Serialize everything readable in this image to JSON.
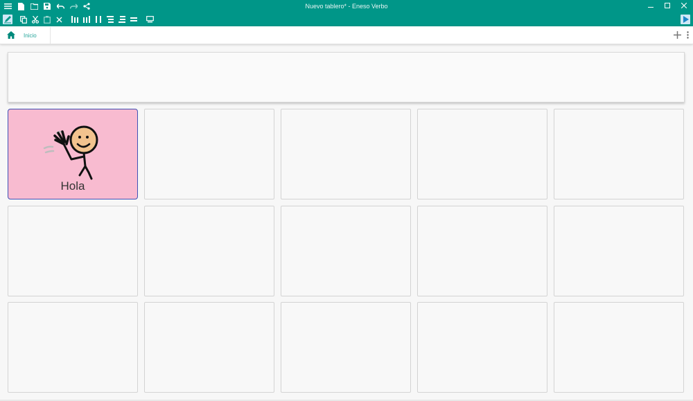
{
  "window": {
    "title": "Nuevo tablero* - Eneso Verbo",
    "accent": "#009688"
  },
  "tabs": [
    {
      "label": "Inicio",
      "icon": "home-icon"
    }
  ],
  "grid": {
    "rows": 3,
    "cols": 5,
    "cells": [
      {
        "label": "Hola",
        "color": "#f8bbd0",
        "icon": "waving-person-icon"
      },
      {
        "label": ""
      },
      {
        "label": ""
      },
      {
        "label": ""
      },
      {
        "label": ""
      },
      {
        "label": ""
      },
      {
        "label": ""
      },
      {
        "label": ""
      },
      {
        "label": ""
      },
      {
        "label": ""
      },
      {
        "label": ""
      },
      {
        "label": ""
      },
      {
        "label": ""
      },
      {
        "label": ""
      },
      {
        "label": ""
      }
    ]
  }
}
